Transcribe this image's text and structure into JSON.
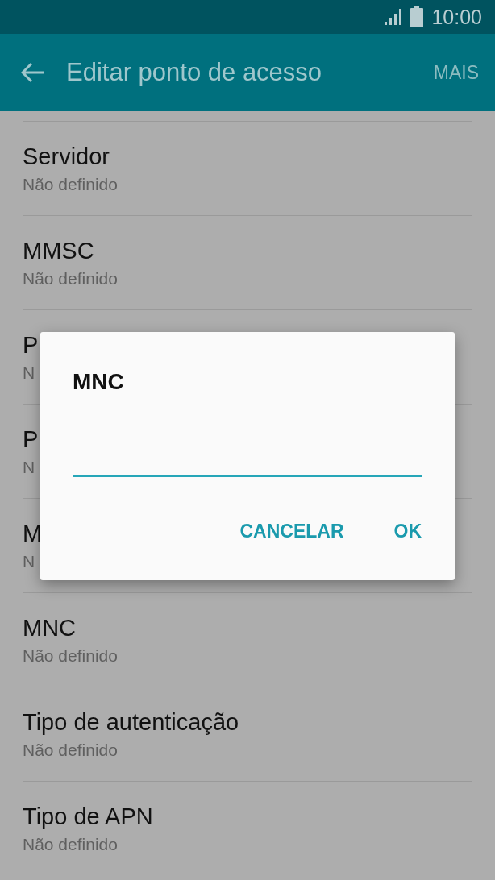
{
  "status_bar": {
    "time": "10:00"
  },
  "app_bar": {
    "title": "Editar ponto de acesso",
    "action": "MAIS"
  },
  "settings": [
    {
      "title": "Servidor",
      "value": "Não definido"
    },
    {
      "title": "MMSC",
      "value": "Não definido"
    },
    {
      "title": "P",
      "value": "N"
    },
    {
      "title": "P",
      "value": "N"
    },
    {
      "title": "M",
      "value": "N"
    },
    {
      "title": "MNC",
      "value": "Não definido"
    },
    {
      "title": "Tipo de autenticação",
      "value": "Não definido"
    },
    {
      "title": "Tipo de APN",
      "value": "Não definido"
    }
  ],
  "dialog": {
    "title": "MNC",
    "buttons": [
      "CANCELAR",
      "OK"
    ]
  }
}
